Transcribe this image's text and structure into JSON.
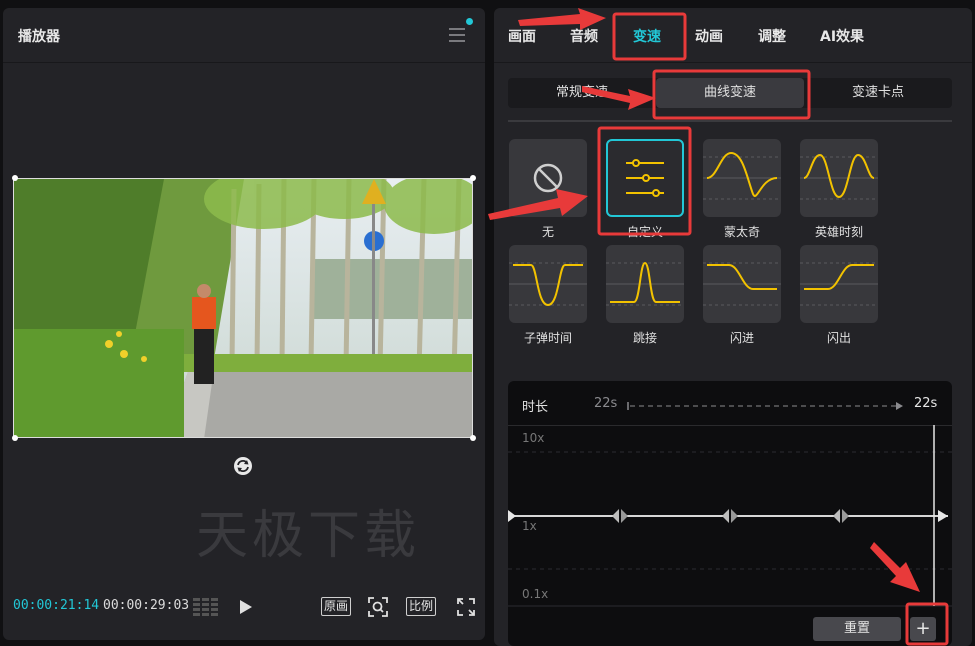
{
  "player": {
    "title": "播放器",
    "watermark": "天极下载",
    "current_time": "00:00:21:14",
    "total_time": "00:00:29:03",
    "btn_original": "原画",
    "btn_ratio": "比例"
  },
  "tabs": [
    "画面",
    "音频",
    "变速",
    "动画",
    "调整",
    "AI效果"
  ],
  "active_tab": "变速",
  "subtabs": [
    "常规变速",
    "曲线变速",
    "变速卡点"
  ],
  "active_subtab": "曲线变速",
  "presets": [
    {
      "label": "无",
      "icon": "none-icon"
    },
    {
      "label": "自定义",
      "icon": "sliders-icon"
    },
    {
      "label": "蒙太奇",
      "icon": "montage-curve-icon"
    },
    {
      "label": "英雄时刻",
      "icon": "hero-curve-icon"
    },
    {
      "label": "子弹时间",
      "icon": "bullet-curve-icon"
    },
    {
      "label": "跳接",
      "icon": "jump-curve-icon"
    },
    {
      "label": "闪进",
      "icon": "flash-in-curve-icon"
    },
    {
      "label": "闪出",
      "icon": "flash-out-curve-icon"
    }
  ],
  "editor": {
    "duration_label": "时长",
    "duration_from": "22s",
    "duration_to": "22s",
    "scale_top": "10x",
    "scale_mid": "1x",
    "scale_bottom": "0.1x",
    "reset_label": "重置",
    "add_label": "+"
  },
  "colors": {
    "accent": "#22c7d6",
    "curve": "#f2c200",
    "highlight": "#e83a3a"
  }
}
